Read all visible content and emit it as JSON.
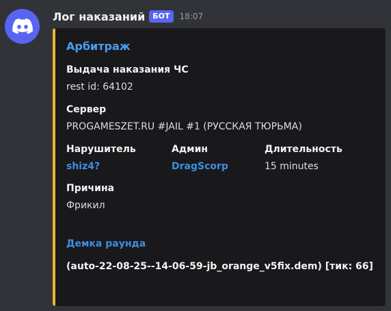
{
  "message": {
    "author": "Лог наказаний",
    "bot_tag": "БОТ",
    "timestamp": "18:07",
    "avatar_icon": "discord-logo-icon",
    "accent_color": "#f0b232"
  },
  "embed": {
    "title": "Арбитраж",
    "fields": {
      "punishment_name": "Выдача наказания ЧС",
      "punishment_value": "rest id: 64102",
      "server_name": "Сервер",
      "server_value": "PROGAMESZET.RU #JAIL #1 (РУССКАЯ ТЮРЬМА)",
      "offender_name": "Нарушитель",
      "offender_value": "shiz4?",
      "admin_name": "Админ",
      "admin_value": "DragScorp",
      "duration_name": "Длительность",
      "duration_value": "15 minutes",
      "reason_name": "Причина",
      "reason_value": "Фрикил"
    },
    "demo_title": "Демка раунда",
    "demo_value": "(auto-22-08-25--14-06-59-jb_orange_v5fix.dem) [тик: 66]"
  }
}
